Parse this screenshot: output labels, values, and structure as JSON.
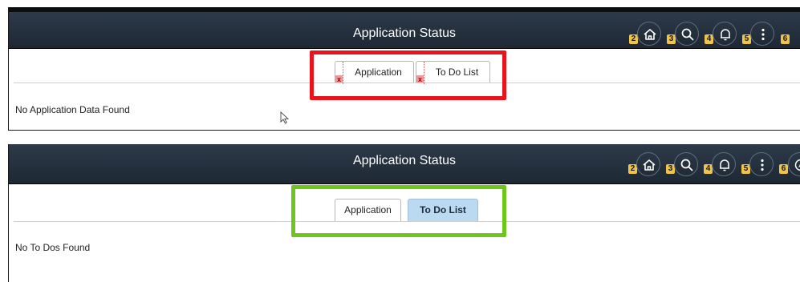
{
  "panels": [
    {
      "title": "Application Status",
      "tabs": [
        {
          "label": "Application",
          "active": false,
          "image_broken": true
        },
        {
          "label": "To Do List",
          "active": false,
          "image_broken": true
        }
      ],
      "message": "No Application Data Found",
      "highlight_color": "#e8141c",
      "header_icons": [
        {
          "badge": "2",
          "icon": "home-icon"
        },
        {
          "badge": "3",
          "icon": "search-icon"
        },
        {
          "badge": "4",
          "icon": "bell-icon"
        },
        {
          "badge": "5",
          "icon": "more-vertical-icon"
        },
        {
          "badge": "6",
          "icon": "nav-icon"
        }
      ]
    },
    {
      "title": "Application Status",
      "tabs": [
        {
          "label": "Application",
          "active": false,
          "image_broken": false
        },
        {
          "label": "To Do List",
          "active": true,
          "image_broken": false
        }
      ],
      "message": "No To Dos Found",
      "highlight_color": "#6cc61c",
      "header_icons": [
        {
          "badge": "2",
          "icon": "home-icon"
        },
        {
          "badge": "3",
          "icon": "search-icon"
        },
        {
          "badge": "4",
          "icon": "bell-icon"
        },
        {
          "badge": "5",
          "icon": "more-vertical-icon"
        },
        {
          "badge": "6",
          "icon": "navigator-icon"
        }
      ]
    }
  ],
  "colors": {
    "header_bg": "#2d3a49",
    "active_tab_bg": "#bcd9f2",
    "badge_bg": "#f0c44a"
  }
}
